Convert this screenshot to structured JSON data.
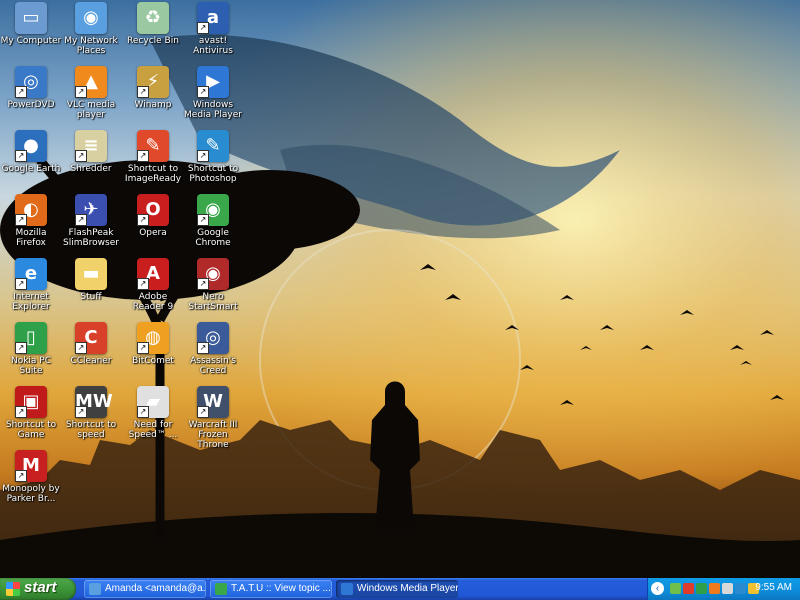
{
  "desktop": {
    "icons": [
      {
        "label": "My Computer",
        "icon": "my-computer-icon",
        "color": "#6b9bd1",
        "sym": "▭",
        "shortcut": false
      },
      {
        "label": "My Network Places",
        "icon": "network-places-icon",
        "color": "#5aa0e0",
        "sym": "◉",
        "shortcut": false
      },
      {
        "label": "Recycle Bin",
        "icon": "recycle-bin-icon",
        "color": "#9ac8a0",
        "sym": "♻",
        "shortcut": false
      },
      {
        "label": "avast! Antivirus",
        "icon": "avast-icon",
        "color": "#2d5fb0",
        "sym": "a",
        "shortcut": true
      },
      {
        "label": "PowerDVD",
        "icon": "powerdvd-icon",
        "color": "#3a79c8",
        "sym": "◎",
        "shortcut": true
      },
      {
        "label": "VLC media player",
        "icon": "vlc-icon",
        "color": "#f08a1c",
        "sym": "▲",
        "shortcut": true
      },
      {
        "label": "Winamp",
        "icon": "winamp-icon",
        "color": "#c8a040",
        "sym": "⚡",
        "shortcut": true
      },
      {
        "label": "Windows Media Player",
        "icon": "media-player-icon",
        "color": "#2f77d4",
        "sym": "▶",
        "shortcut": true
      },
      {
        "label": "Google Earth",
        "icon": "google-earth-icon",
        "color": "#2b6fbd",
        "sym": "●",
        "shortcut": true
      },
      {
        "label": "Shredder",
        "icon": "shredder-icon",
        "color": "#d8d0a0",
        "sym": "≡",
        "shortcut": true
      },
      {
        "label": "Shortcut to ImageReady",
        "icon": "imageready-icon",
        "color": "#e04a2a",
        "sym": "✎",
        "shortcut": true
      },
      {
        "label": "Shortcut to Photoshop",
        "icon": "photoshop-icon",
        "color": "#2a8cd0",
        "sym": "✎",
        "shortcut": true
      },
      {
        "label": "Mozilla Firefox",
        "icon": "firefox-icon",
        "color": "#e06a1a",
        "sym": "◐",
        "shortcut": true
      },
      {
        "label": "FlashPeak SlimBrowser",
        "icon": "slimbrowser-icon",
        "color": "#3a4fb0",
        "sym": "✈",
        "shortcut": true
      },
      {
        "label": "Opera",
        "icon": "opera-icon",
        "color": "#c81e1e",
        "sym": "O",
        "shortcut": true
      },
      {
        "label": "Google Chrome",
        "icon": "chrome-icon",
        "color": "#3aa84a",
        "sym": "◉",
        "shortcut": true
      },
      {
        "label": "Internet Explorer",
        "icon": "internet-explorer-icon",
        "color": "#2b8ae0",
        "sym": "e",
        "shortcut": true
      },
      {
        "label": "Stuff",
        "icon": "folder-icon",
        "color": "#f1d26a",
        "sym": "▬",
        "shortcut": false
      },
      {
        "label": "Adobe Reader 9",
        "icon": "adobe-reader-icon",
        "color": "#c81e1e",
        "sym": "A",
        "shortcut": true
      },
      {
        "label": "Nero StartSmart",
        "icon": "nero-icon",
        "color": "#b02a2a",
        "sym": "◉",
        "shortcut": true
      },
      {
        "label": "Nokia PC Suite",
        "icon": "nokia-icon",
        "color": "#2fa04a",
        "sym": "▯",
        "shortcut": true
      },
      {
        "label": "CCleaner",
        "icon": "ccleaner-icon",
        "color": "#d8402a",
        "sym": "C",
        "shortcut": true
      },
      {
        "label": "BitComet",
        "icon": "bitcomet-icon",
        "color": "#f0a020",
        "sym": "◍",
        "shortcut": true
      },
      {
        "label": "Assassin's Creed",
        "icon": "assassins-creed-icon",
        "color": "#3a5a9a",
        "sym": "◎",
        "shortcut": true
      },
      {
        "label": "Shortcut to Game",
        "icon": "game-icon",
        "color": "#c01a1a",
        "sym": "▣",
        "shortcut": true
      },
      {
        "label": "Shortcut to speed",
        "icon": "speed-icon",
        "color": "#404040",
        "sym": "MW",
        "shortcut": true
      },
      {
        "label": "Need for Speed™ ...",
        "icon": "need-for-speed-icon",
        "color": "#e0e0e0",
        "sym": "▰",
        "shortcut": true
      },
      {
        "label": "Warcraft III Frozen Throne",
        "icon": "warcraft-icon",
        "color": "#40506a",
        "sym": "W",
        "shortcut": true
      },
      {
        "label": "Monopoly by Parker Br...",
        "icon": "monopoly-icon",
        "color": "#c82020",
        "sym": "M",
        "shortcut": true
      }
    ]
  },
  "taskbar": {
    "start_label": "start",
    "tasks": [
      {
        "label": "Amanda <amanda@a...",
        "icon": "browser-icon",
        "color": "#5aa0e0",
        "active": false
      },
      {
        "label": "T.A.T.U :: View topic ...",
        "icon": "chrome-icon",
        "color": "#3aa84a",
        "active": false
      },
      {
        "label": "Windows Media Player",
        "icon": "media-player-icon",
        "color": "#2f77d4",
        "active": true
      }
    ],
    "tray": {
      "chevron": "‹",
      "icons": [
        {
          "name": "network-tray-icon",
          "color": "#6fbf4a"
        },
        {
          "name": "security-tray-icon",
          "color": "#e03a2a"
        },
        {
          "name": "nero-tray-icon",
          "color": "#2fa04a"
        },
        {
          "name": "antivirus-tray-icon",
          "color": "#f07a1a"
        },
        {
          "name": "volume-tray-icon",
          "color": "#d8d8d8"
        },
        {
          "name": "update-tray-icon",
          "color": "#2a8ad0"
        },
        {
          "name": "bluetooth-tray-icon",
          "color": "#f0c030"
        }
      ],
      "clock": "9:55 AM"
    }
  }
}
